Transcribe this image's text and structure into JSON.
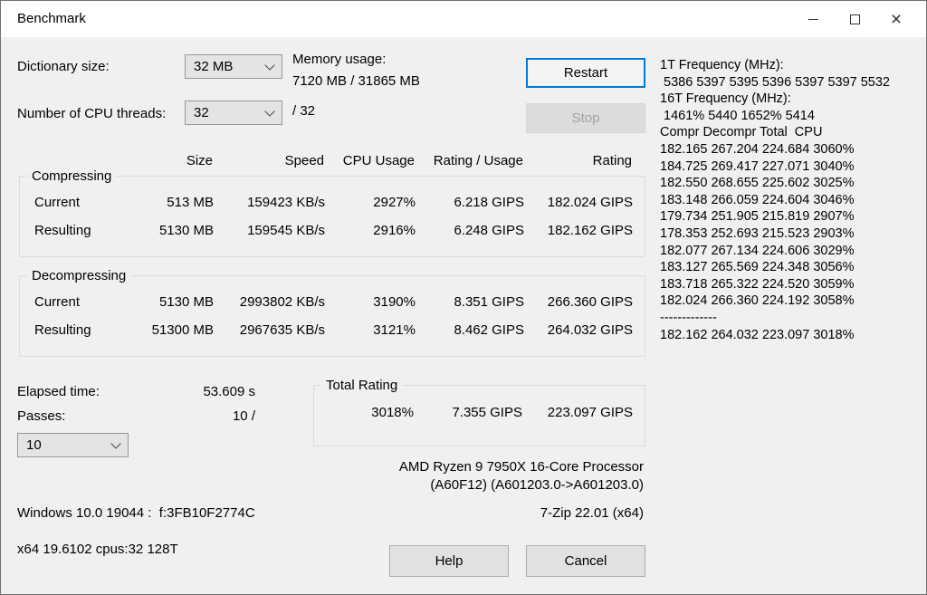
{
  "window": {
    "title": "Benchmark"
  },
  "icons": {
    "close": "×"
  },
  "colors": {
    "accent_blue": "#0078d7",
    "dialog_bg": "#f0f0f0",
    "titlebar_bg": "#ffffff",
    "disabled_text": "#a3a3a3"
  },
  "controls": {
    "dictionary_size_label": "Dictionary size:",
    "dictionary_size_value": "32 MB",
    "cpu_threads_label": "Number of CPU threads:",
    "cpu_threads_value": "32",
    "cpu_threads_suffix": "/ 32",
    "memory_usage_label": "Memory usage:",
    "memory_usage_value": "7120 MB / 31865 MB",
    "restart_label": "Restart",
    "stop_label": "Stop"
  },
  "table": {
    "headers": [
      "Size",
      "Speed",
      "CPU Usage",
      "Rating / Usage",
      "Rating"
    ],
    "compressing": {
      "label": "Compressing",
      "rows": [
        {
          "name": "Current",
          "size": "513 MB",
          "speed": "159423 KB/s",
          "cpu_usage": "2927%",
          "rating_usage": "6.218 GIPS",
          "rating": "182.024 GIPS"
        },
        {
          "name": "Resulting",
          "size": "5130 MB",
          "speed": "159545 KB/s",
          "cpu_usage": "2916%",
          "rating_usage": "6.248 GIPS",
          "rating": "182.162 GIPS"
        }
      ]
    },
    "decompressing": {
      "label": "Decompressing",
      "rows": [
        {
          "name": "Current",
          "size": "5130 MB",
          "speed": "2993802 KB/s",
          "cpu_usage": "3190%",
          "rating_usage": "8.351 GIPS",
          "rating": "266.360 GIPS"
        },
        {
          "name": "Resulting",
          "size": "51300 MB",
          "speed": "2967635 KB/s",
          "cpu_usage": "3121%",
          "rating_usage": "8.462 GIPS",
          "rating": "264.032 GIPS"
        }
      ]
    }
  },
  "summary": {
    "elapsed_label": "Elapsed time:",
    "elapsed_value": "53.609 s",
    "passes_label": "Passes:",
    "passes_value": "10 /",
    "passes_selected": "10",
    "total_rating": {
      "label": "Total Rating",
      "cpu_usage": "3018%",
      "rating_usage": "7.355 GIPS",
      "rating": "223.097 GIPS"
    }
  },
  "footer": {
    "os_info": "Windows 10.0 19044 :  f:3FB10F2774C",
    "build_info": "x64 19.6102 cpus:32 128T",
    "cpu_name": "AMD Ryzen 9 7950X 16-Core Processor",
    "cpu_id": "(A60F12) (A601203.0->A601203.0)",
    "app_version": "7-Zip 22.01 (x64)",
    "help_label": "Help",
    "cancel_label": "Cancel"
  },
  "log": {
    "lines": [
      "1T Frequency (MHz):",
      " 5386 5397 5395 5396 5397 5397 5532",
      "16T Frequency (MHz):",
      " 1461% 5440 1652% 5414",
      "Compr Decompr Total  CPU",
      "182.165 267.204 224.684 3060%",
      "184.725 269.417 227.071 3040%",
      "182.550 268.655 225.602 3025%",
      "183.148 266.059 224.604 3046%",
      "179.734 251.905 215.819 2907%",
      "178.353 252.693 215.523 2903%",
      "182.077 267.134 224.606 3029%",
      "183.127 265.569 224.348 3056%",
      "183.718 265.322 224.520 3059%",
      "182.024 266.360 224.192 3058%",
      "-------------",
      "182.162 264.032 223.097 3018%"
    ]
  }
}
